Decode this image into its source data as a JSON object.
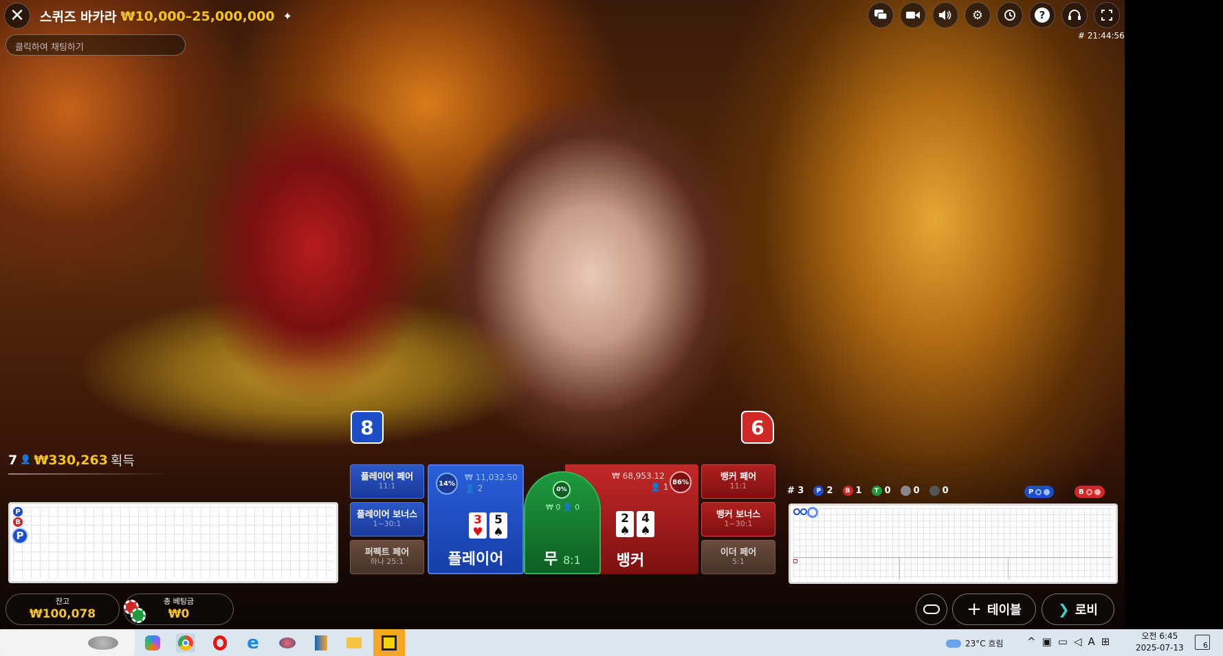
{
  "header": {
    "title": "스퀴즈 바카라",
    "limits": "₩10,000–25,000,000"
  },
  "chat": {
    "placeholder": "클릭하여 채팅하기"
  },
  "round_time": "# 21:44:56",
  "top_icons": [
    "chat-icon",
    "video-icon",
    "volume-icon",
    "gear-icon",
    "history-icon",
    "help-icon",
    "headset-icon",
    "fullscreen-icon"
  ],
  "winners": {
    "count": "7",
    "amount": "₩330,263",
    "label": "획득"
  },
  "scores": {
    "player": "8",
    "banker": "6"
  },
  "side_bets_left": [
    {
      "label": "플레이어 페어",
      "odds": "11:1"
    },
    {
      "label": "플레이어 보너스",
      "odds": "1~30:1"
    },
    {
      "label": "퍼펙트 페어",
      "odds": "하나 25:1"
    }
  ],
  "side_bets_right": [
    {
      "label": "뱅커 페어",
      "odds": "11:1"
    },
    {
      "label": "뱅커 보너스",
      "odds": "1~30:1"
    },
    {
      "label": "이더 페어",
      "odds": "5:1"
    }
  ],
  "player_spot": {
    "label": "플레이어",
    "percent": "14%",
    "total": "₩ 11,032.50",
    "players": "2",
    "cards": [
      {
        "rank": "3",
        "suit": "♥",
        "red": true
      },
      {
        "rank": "5",
        "suit": "♠",
        "red": false
      }
    ]
  },
  "tie_spot": {
    "label": "무",
    "odds": "8:1",
    "percent": "0%",
    "total": "₩ 0",
    "players": "0"
  },
  "banker_spot": {
    "label": "뱅커",
    "percent": "86%",
    "total": "₩ 68,953.12",
    "players": "1",
    "cards": [
      {
        "rank": "2",
        "suit": "♠",
        "red": false
      },
      {
        "rank": "4",
        "suit": "♠",
        "red": false
      }
    ]
  },
  "roadmap_stats": {
    "round": "# 3",
    "p": "2",
    "b": "1",
    "t": "0",
    "pp": "0",
    "bp": "0",
    "p_label": "P",
    "b_label": "B"
  },
  "bead_road": [
    {
      "t": "P",
      "c": "#1d4ec8"
    },
    {
      "t": "B",
      "c": "#d02727"
    },
    {
      "t": "P",
      "c": "#1d4ec8"
    }
  ],
  "balance": {
    "label": "잔고",
    "value": "₩100,078"
  },
  "total_bet": {
    "label": "총 베팅금",
    "value": "₩0"
  },
  "nav": {
    "table": "테이블",
    "lobby": "로비"
  },
  "taskbar": {
    "weather": "23°C 흐림",
    "time": "오전 6:45",
    "date": "2025-07-13",
    "notifications": "6",
    "ime": "A"
  },
  "colors": {
    "gold": "#f5c518",
    "player_blue": "#1d4ec8",
    "banker_red": "#d02727",
    "tie_green": "#1e9a3e"
  }
}
